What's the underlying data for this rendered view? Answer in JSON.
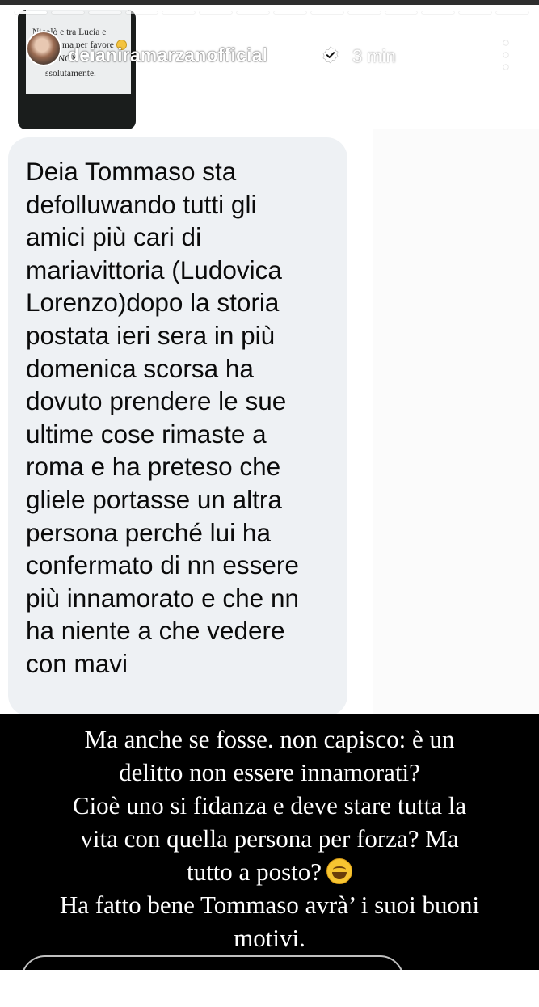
{
  "header": {
    "username": "deianiramarzanofficial",
    "timestamp": "3 min",
    "verified_icon": "verified-badge-icon",
    "more_icon": "more-vertical-icon",
    "progress_segments": 14
  },
  "thumbnail": {
    "line1": "Nicolò e tra Lucia e",
    "line2": "ma per favore",
    "line3": "NON",
    "line4": "ssolutamente."
  },
  "message": {
    "lines": [
      "Deia Tommaso sta",
      "defolluwando tutti gli",
      "amici più cari di",
      "mariavittoria (Ludovica",
      "Lorenzo)dopo la storia",
      "postata ieri sera in più",
      "domenica scorsa ha",
      "dovuto prendere le sue",
      "ultime cose rimaste a",
      "roma e ha preteso che",
      "gliele portasse un altra",
      "persona perché lui ha",
      "confermato di nn essere",
      "più innamorato e che nn",
      "ha niente a che vedere",
      "con mavi"
    ]
  },
  "caption": {
    "lines": [
      "Ma anche se fosse. non capisco: è un",
      "delitto non essere innamorati?",
      "Cioè uno si fidanza e deve stare tutta la",
      "vita con quella persona per forza? Ma",
      "tutto a posto?",
      "Ha fatto bene Tommaso avrà’ i suoi buoni",
      "motivi."
    ],
    "emoji": "laughing-tears-emoji"
  },
  "colors": {
    "bubble": "#eef1f4",
    "caption_bg": "#000000",
    "text": "#0b0b0b"
  }
}
